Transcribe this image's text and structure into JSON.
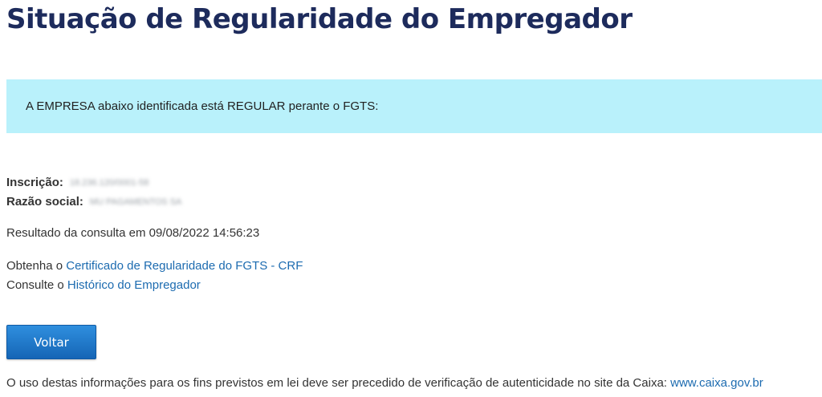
{
  "page_title": "Situação de Regularidade do Empregador",
  "alert": {
    "message": "A EMPRESA abaixo identificada está REGULAR perante o FGTS:"
  },
  "company": {
    "inscricao_label": "Inscrição:",
    "inscricao_value": "18.236.120/0001-58",
    "razao_social_label": "Razão social:",
    "razao_social_value": "MU PAGAMENTOS SA"
  },
  "result": {
    "text": "Resultado da consulta em 09/08/2022 14:56:23"
  },
  "links": {
    "crf_prefix": "Obtenha o ",
    "crf_link": "Certificado de Regularidade do FGTS - CRF",
    "historico_prefix": "Consulte o ",
    "historico_link": "Histórico do Empregador"
  },
  "buttons": {
    "voltar_label": "Voltar"
  },
  "footer": {
    "text": "O uso destas informações para os fins previstos em lei deve ser precedido de verificação de autenticidade no site da Caixa: ",
    "link": "www.caixa.gov.br"
  },
  "colors": {
    "title": "#1d2b5c",
    "alert_background": "#b9f1fb",
    "link": "#1c6bb0",
    "button": "#1f7ad0"
  }
}
